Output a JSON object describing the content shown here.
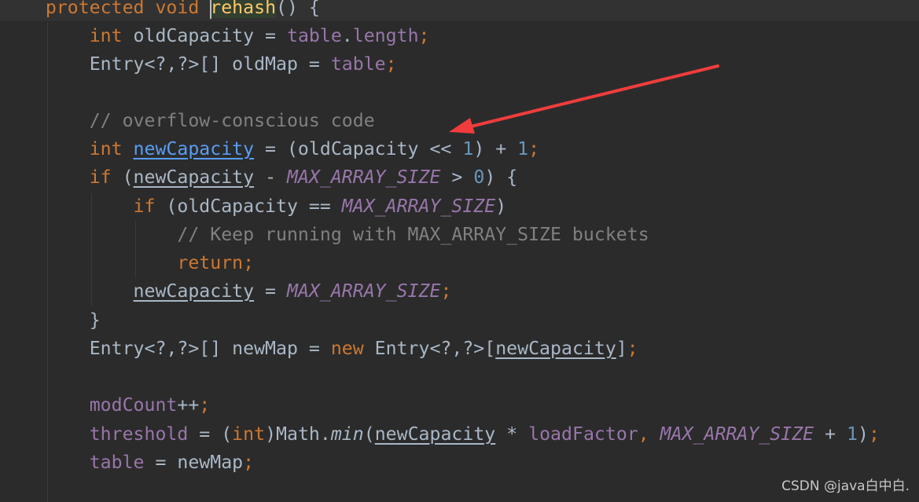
{
  "editor": {
    "lines": [
      {
        "indent": 4,
        "tokens": [
          {
            "t": "protected ",
            "c": "kw"
          },
          {
            "t": "void ",
            "c": "kw"
          },
          {
            "t": "rehash",
            "c": "method"
          },
          {
            "t": "() {",
            "c": "plain"
          }
        ]
      },
      {
        "indent": 8,
        "tokens": [
          {
            "t": "int ",
            "c": "kw"
          },
          {
            "t": "oldCapacity = ",
            "c": "plain"
          },
          {
            "t": "table",
            "c": "field"
          },
          {
            "t": ".",
            "c": "plain"
          },
          {
            "t": "length",
            "c": "field"
          },
          {
            "t": ";",
            "c": "kw"
          }
        ]
      },
      {
        "indent": 8,
        "tokens": [
          {
            "t": "Entry<?,?>[] oldMap = ",
            "c": "plain"
          },
          {
            "t": "table",
            "c": "field"
          },
          {
            "t": ";",
            "c": "kw"
          }
        ]
      },
      {
        "indent": 8,
        "tokens": []
      },
      {
        "indent": 8,
        "tokens": [
          {
            "t": "// overflow-conscious code",
            "c": "comment"
          }
        ]
      },
      {
        "indent": 8,
        "tokens": [
          {
            "t": "int ",
            "c": "kw"
          },
          {
            "t": "newCapacity",
            "c": "decl"
          },
          {
            "t": " = (oldCapacity << ",
            "c": "plain"
          },
          {
            "t": "1",
            "c": "num"
          },
          {
            "t": ") + ",
            "c": "plain"
          },
          {
            "t": "1",
            "c": "num"
          },
          {
            "t": ";",
            "c": "kw"
          }
        ]
      },
      {
        "indent": 8,
        "tokens": [
          {
            "t": "if ",
            "c": "kw"
          },
          {
            "t": "(",
            "c": "plain"
          },
          {
            "t": "newCapacity",
            "c": "uvar"
          },
          {
            "t": " - ",
            "c": "plain"
          },
          {
            "t": "MAX_ARRAY_SIZE",
            "c": "const"
          },
          {
            "t": " > ",
            "c": "plain"
          },
          {
            "t": "0",
            "c": "num"
          },
          {
            "t": ") {",
            "c": "plain"
          }
        ]
      },
      {
        "indent": 12,
        "tokens": [
          {
            "t": "if ",
            "c": "kw"
          },
          {
            "t": "(oldCapacity == ",
            "c": "plain"
          },
          {
            "t": "MAX_ARRAY_SIZE",
            "c": "const"
          },
          {
            "t": ")",
            "c": "plain"
          }
        ]
      },
      {
        "indent": 16,
        "tokens": [
          {
            "t": "// Keep running with MAX_ARRAY_SIZE buckets",
            "c": "comment"
          }
        ]
      },
      {
        "indent": 16,
        "tokens": [
          {
            "t": "return;",
            "c": "kw"
          }
        ]
      },
      {
        "indent": 12,
        "tokens": [
          {
            "t": "newCapacity",
            "c": "uvar"
          },
          {
            "t": " = ",
            "c": "plain"
          },
          {
            "t": "MAX_ARRAY_SIZE",
            "c": "const"
          },
          {
            "t": ";",
            "c": "kw"
          }
        ]
      },
      {
        "indent": 8,
        "tokens": [
          {
            "t": "}",
            "c": "plain"
          }
        ]
      },
      {
        "indent": 8,
        "tokens": [
          {
            "t": "Entry<?,?>[] newMap = ",
            "c": "plain"
          },
          {
            "t": "new ",
            "c": "kw"
          },
          {
            "t": "Entry<?,?>[",
            "c": "plain"
          },
          {
            "t": "newCapacity",
            "c": "uvar"
          },
          {
            "t": "]",
            "c": "plain"
          },
          {
            "t": ";",
            "c": "kw"
          }
        ]
      },
      {
        "indent": 8,
        "tokens": []
      },
      {
        "indent": 8,
        "tokens": [
          {
            "t": "modCount",
            "c": "field"
          },
          {
            "t": "++",
            "c": "plain"
          },
          {
            "t": ";",
            "c": "kw"
          }
        ]
      },
      {
        "indent": 8,
        "tokens": [
          {
            "t": "threshold",
            "c": "field"
          },
          {
            "t": " = (",
            "c": "plain"
          },
          {
            "t": "int",
            "c": "kw"
          },
          {
            "t": ")Math.",
            "c": "plain"
          },
          {
            "t": "min",
            "c": "static"
          },
          {
            "t": "(",
            "c": "plain"
          },
          {
            "t": "newCapacity",
            "c": "uvar"
          },
          {
            "t": " * ",
            "c": "plain"
          },
          {
            "t": "loadFactor",
            "c": "field"
          },
          {
            "t": ", ",
            "c": "kw"
          },
          {
            "t": "MAX_ARRAY_SIZE",
            "c": "const"
          },
          {
            "t": " + ",
            "c": "plain"
          },
          {
            "t": "1",
            "c": "num"
          },
          {
            "t": ")",
            "c": "plain"
          },
          {
            "t": ";",
            "c": "kw"
          }
        ]
      },
      {
        "indent": 8,
        "tokens": [
          {
            "t": "table",
            "c": "field"
          },
          {
            "t": " = newMap",
            "c": "plain"
          },
          {
            "t": ";",
            "c": "kw"
          }
        ]
      }
    ]
  },
  "annotation": {
    "arrow_color": "#f03c3c"
  },
  "watermark": "CSDN @java白中白."
}
